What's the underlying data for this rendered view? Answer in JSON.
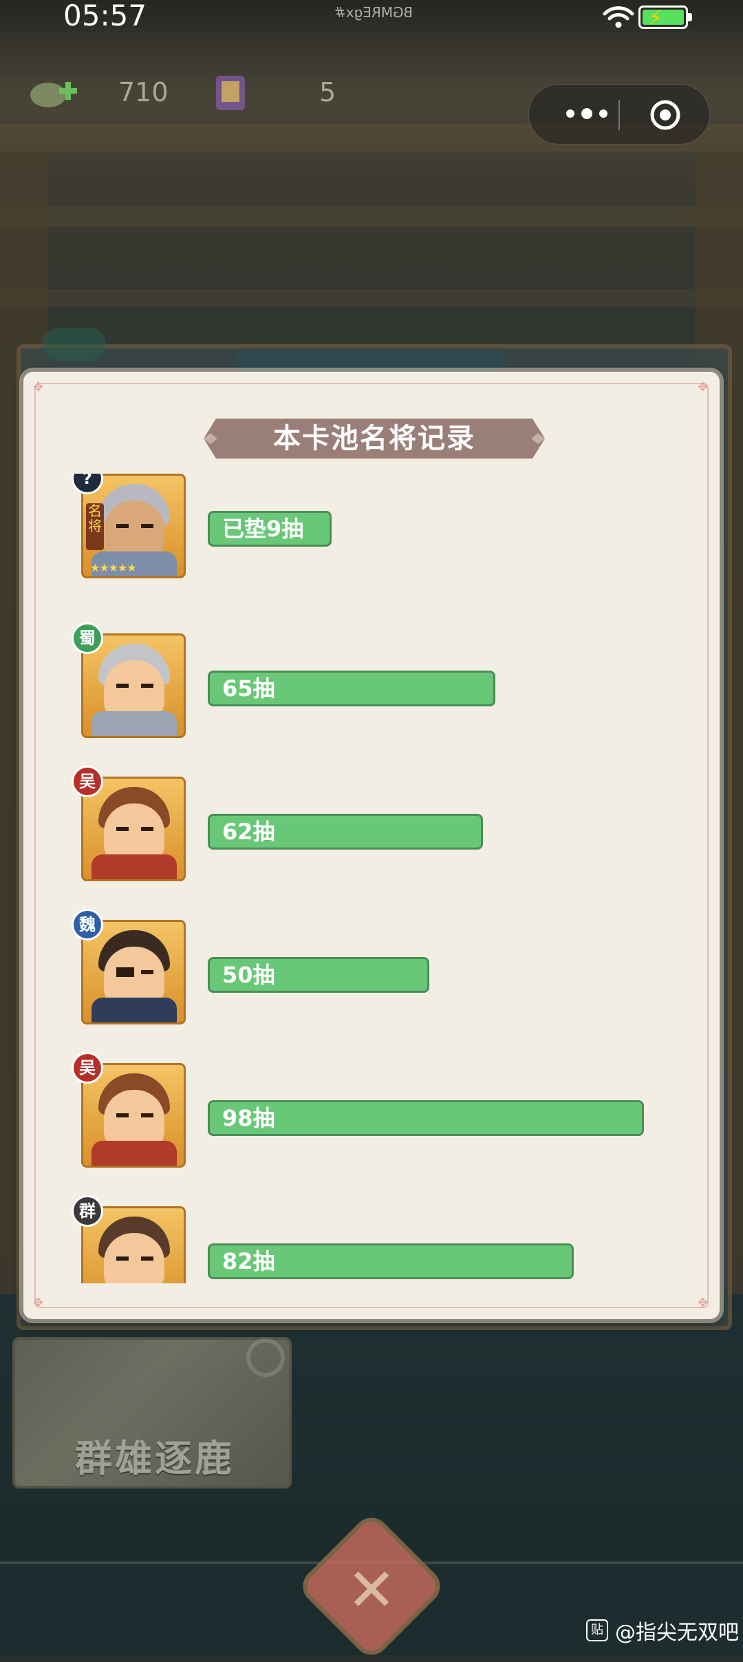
{
  "status_bar": {
    "time": "05:57",
    "mirrored_tag": "BGMREgx#",
    "wifi_icon": "wifi-icon",
    "battery_icon": "battery-charging-icon"
  },
  "resources": [
    {
      "icon": "jade-plus-icon",
      "value": "710"
    },
    {
      "icon": "scroll-token-icon",
      "value": "5"
    }
  ],
  "capsule": {
    "menu_icon": "more-dots-icon",
    "close_icon": "target-circle-icon"
  },
  "modal": {
    "title": "本卡池名将记录",
    "records": [
      {
        "faction": "?",
        "faction_color": "#1d2b3a",
        "label": "已垫9抽",
        "draws": 9,
        "highlight": "unknown-general"
      },
      {
        "faction": "蜀",
        "faction_color": "#3aa05a",
        "label": "65抽",
        "draws": 65
      },
      {
        "faction": "吴",
        "faction_color": "#b5302a",
        "label": "62抽",
        "draws": 62
      },
      {
        "faction": "魏",
        "faction_color": "#2f5fa8",
        "label": "50抽",
        "draws": 50
      },
      {
        "faction": "吴",
        "faction_color": "#b5302a",
        "label": "98抽",
        "draws": 98
      },
      {
        "faction": "群",
        "faction_color": "#3a3a3a",
        "label": "82抽",
        "draws": 82
      }
    ],
    "first_card": {
      "side_tag": "名将",
      "stars": "★★★★★"
    }
  },
  "banner": {
    "text": "群雄逐鹿"
  },
  "watermark": {
    "icon": "贴",
    "text": "@指尖无双吧"
  },
  "colors": {
    "bar": "#69c878",
    "bar_border": "#4a8e57",
    "title_ribbon": "#9a7f78"
  }
}
